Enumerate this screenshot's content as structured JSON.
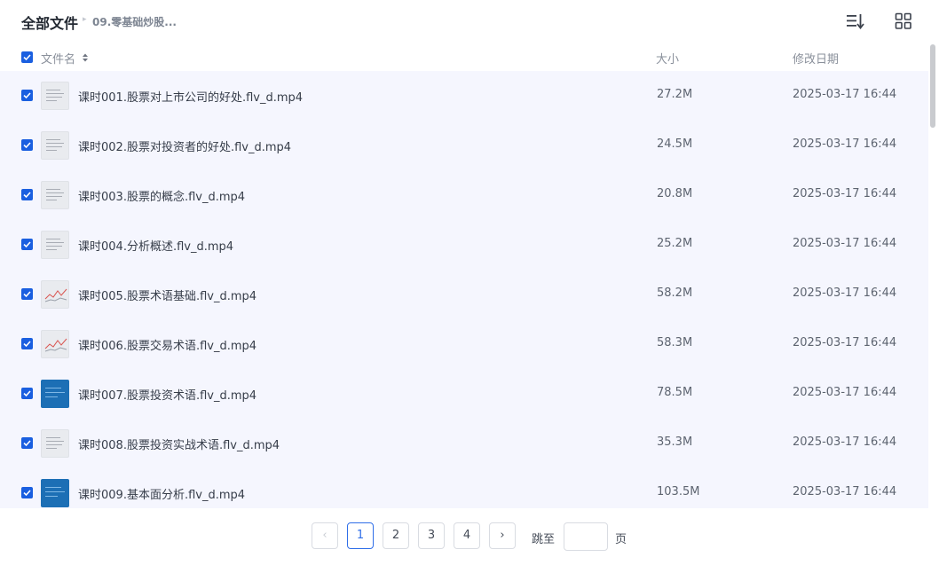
{
  "breadcrumb": {
    "root": "全部文件",
    "separator": "▸",
    "current": "09.零基础炒股..."
  },
  "toolbar": {
    "sort_icon": "sort-list-icon",
    "view_icon": "grid-view-icon"
  },
  "columns": {
    "name": "文件名",
    "size": "大小",
    "date": "修改日期"
  },
  "select_all_checked": true,
  "files": [
    {
      "name": "课时001.股票对上市公司的好处.flv_d.mp4",
      "size": "27.2M",
      "date": "2025-03-17 16:44",
      "thumb": "doc",
      "checked": true
    },
    {
      "name": "课时002.股票对投资者的好处.flv_d.mp4",
      "size": "24.5M",
      "date": "2025-03-17 16:44",
      "thumb": "doc",
      "checked": true
    },
    {
      "name": "课时003.股票的概念.flv_d.mp4",
      "size": "20.8M",
      "date": "2025-03-17 16:44",
      "thumb": "doc",
      "checked": true
    },
    {
      "name": "课时004.分析概述.flv_d.mp4",
      "size": "25.2M",
      "date": "2025-03-17 16:44",
      "thumb": "doc",
      "checked": true
    },
    {
      "name": "课时005.股票术语基础.flv_d.mp4",
      "size": "58.2M",
      "date": "2025-03-17 16:44",
      "thumb": "chart",
      "checked": true
    },
    {
      "name": "课时006.股票交易术语.flv_d.mp4",
      "size": "58.3M",
      "date": "2025-03-17 16:44",
      "thumb": "chart",
      "checked": true
    },
    {
      "name": "课时007.股票投资术语.flv_d.mp4",
      "size": "78.5M",
      "date": "2025-03-17 16:44",
      "thumb": "blue",
      "checked": true
    },
    {
      "name": "课时008.股票投资实战术语.flv_d.mp4",
      "size": "35.3M",
      "date": "2025-03-17 16:44",
      "thumb": "doc",
      "checked": true
    },
    {
      "name": "课时009.基本面分析.flv_d.mp4",
      "size": "103.5M",
      "date": "2025-03-17 16:44",
      "thumb": "blue",
      "checked": true
    }
  ],
  "pagination": {
    "prev": "‹",
    "next": "›",
    "pages": [
      "1",
      "2",
      "3",
      "4"
    ],
    "current": "1",
    "jump_label": "跳至",
    "jump_suffix": "页",
    "jump_value": ""
  },
  "colors": {
    "accent": "#2f6ee8",
    "checkbox": "#1a5fe0",
    "row_bg": "#f5f6fe"
  }
}
